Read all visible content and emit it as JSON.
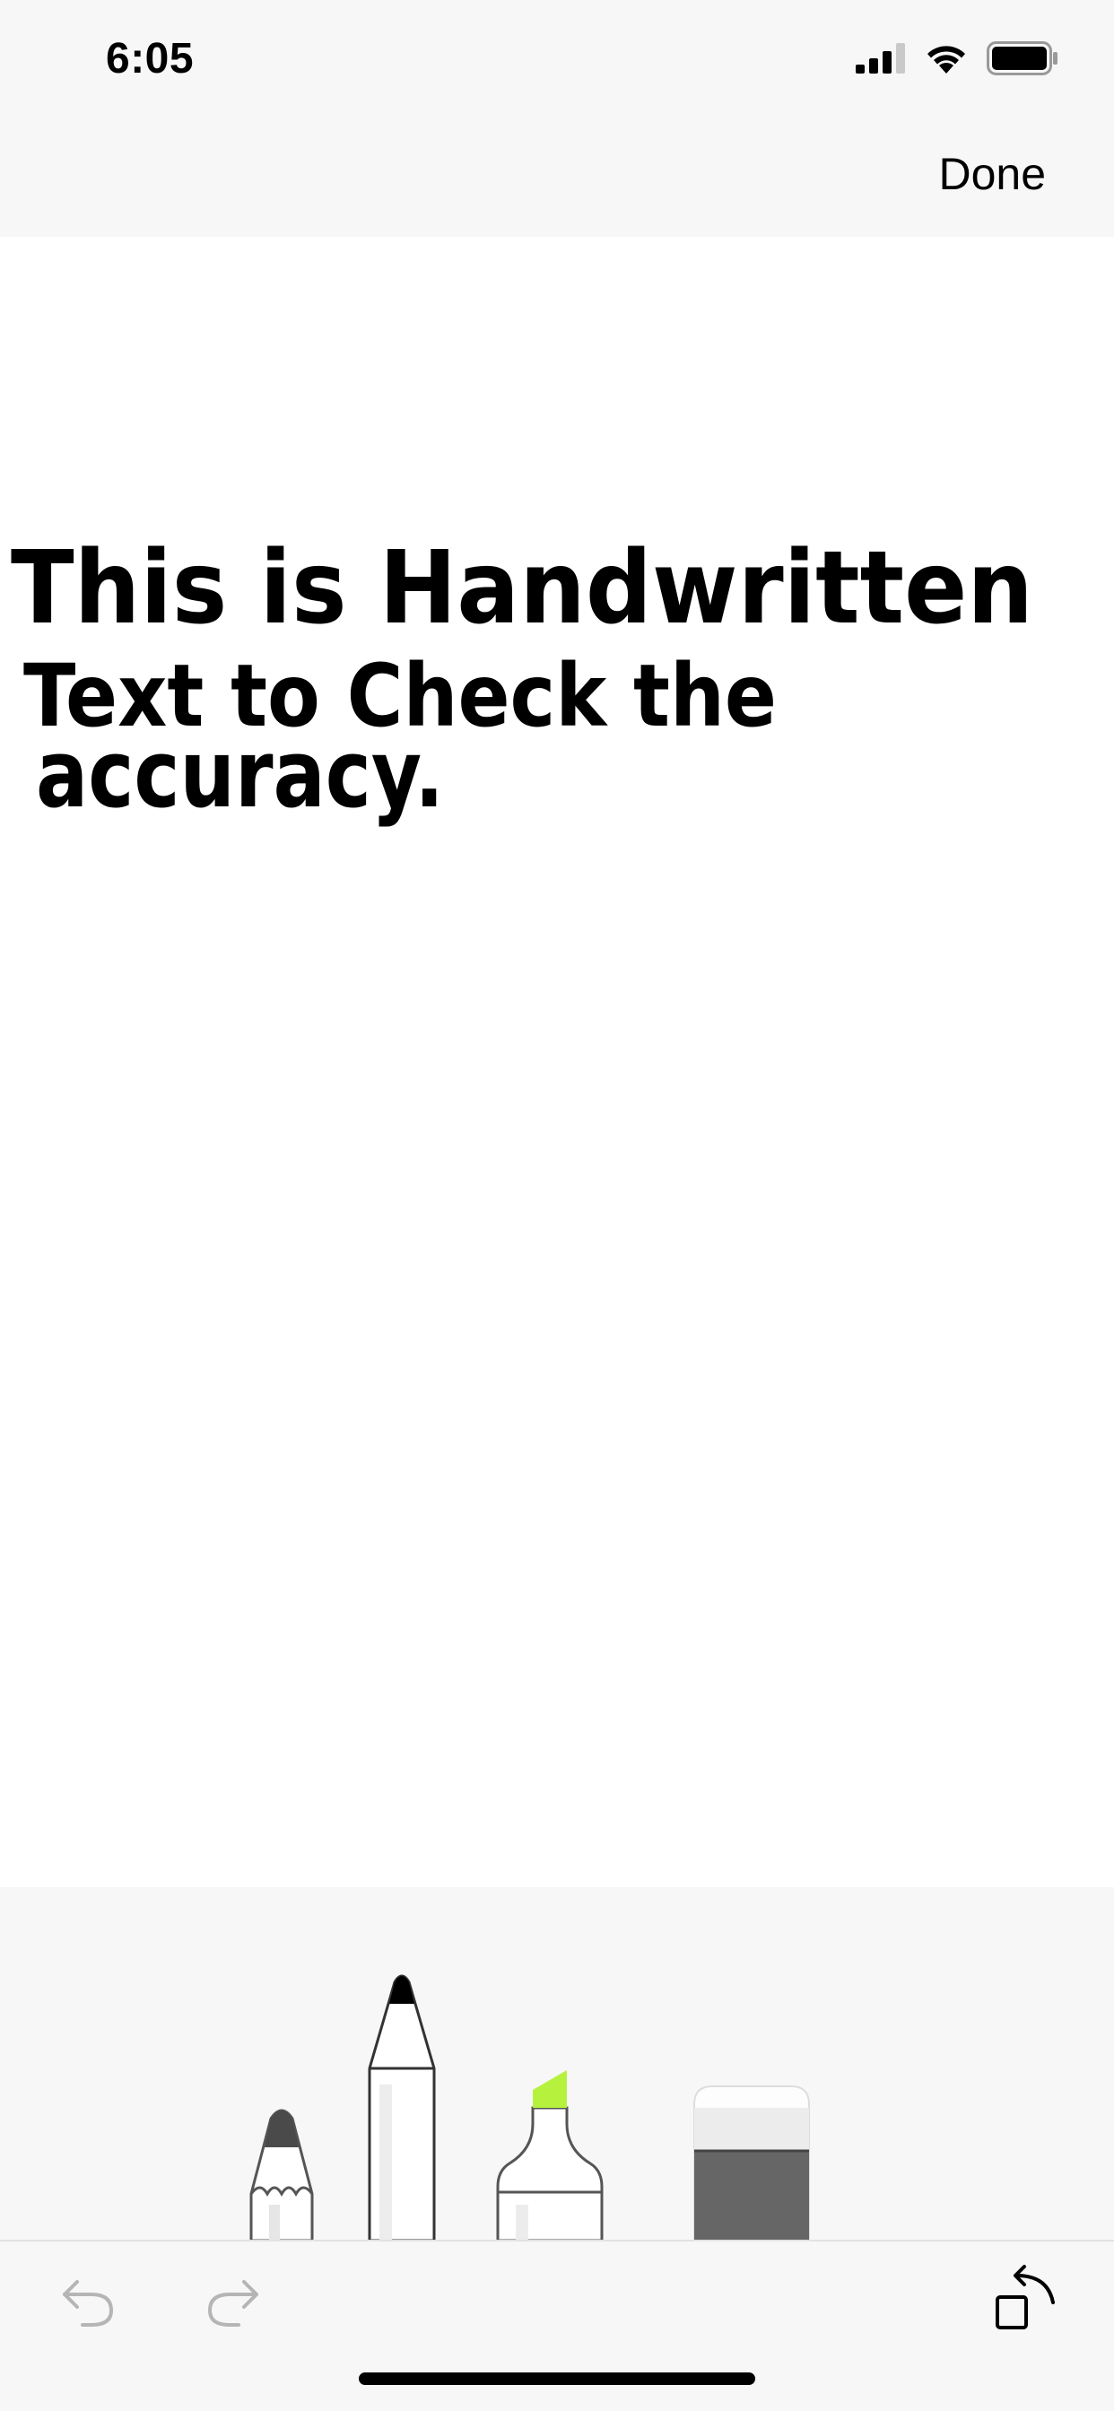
{
  "status_bar": {
    "time": "6:05",
    "icons": [
      "cellular-signal-icon",
      "wifi-icon",
      "battery-icon"
    ]
  },
  "nav": {
    "done_label": "Done"
  },
  "canvas": {
    "handwritten_lines": [
      "This  is  Handwritten",
      "Text  to  Check  the",
      "accuracy."
    ],
    "ink_color": "#000000"
  },
  "tools": [
    {
      "name": "pencil",
      "icon": "pencil-icon",
      "tip_color": "#4a4a4a"
    },
    {
      "name": "pen",
      "icon": "pen-icon",
      "tip_color": "#000000"
    },
    {
      "name": "highlighter",
      "icon": "highlighter-icon",
      "tip_color": "#b6f23d"
    },
    {
      "name": "eraser",
      "icon": "eraser-icon",
      "tip_color": "#666666"
    }
  ],
  "bottom_bar": {
    "icons": [
      "undo-icon",
      "redo-icon",
      "rotate-icon"
    ]
  }
}
